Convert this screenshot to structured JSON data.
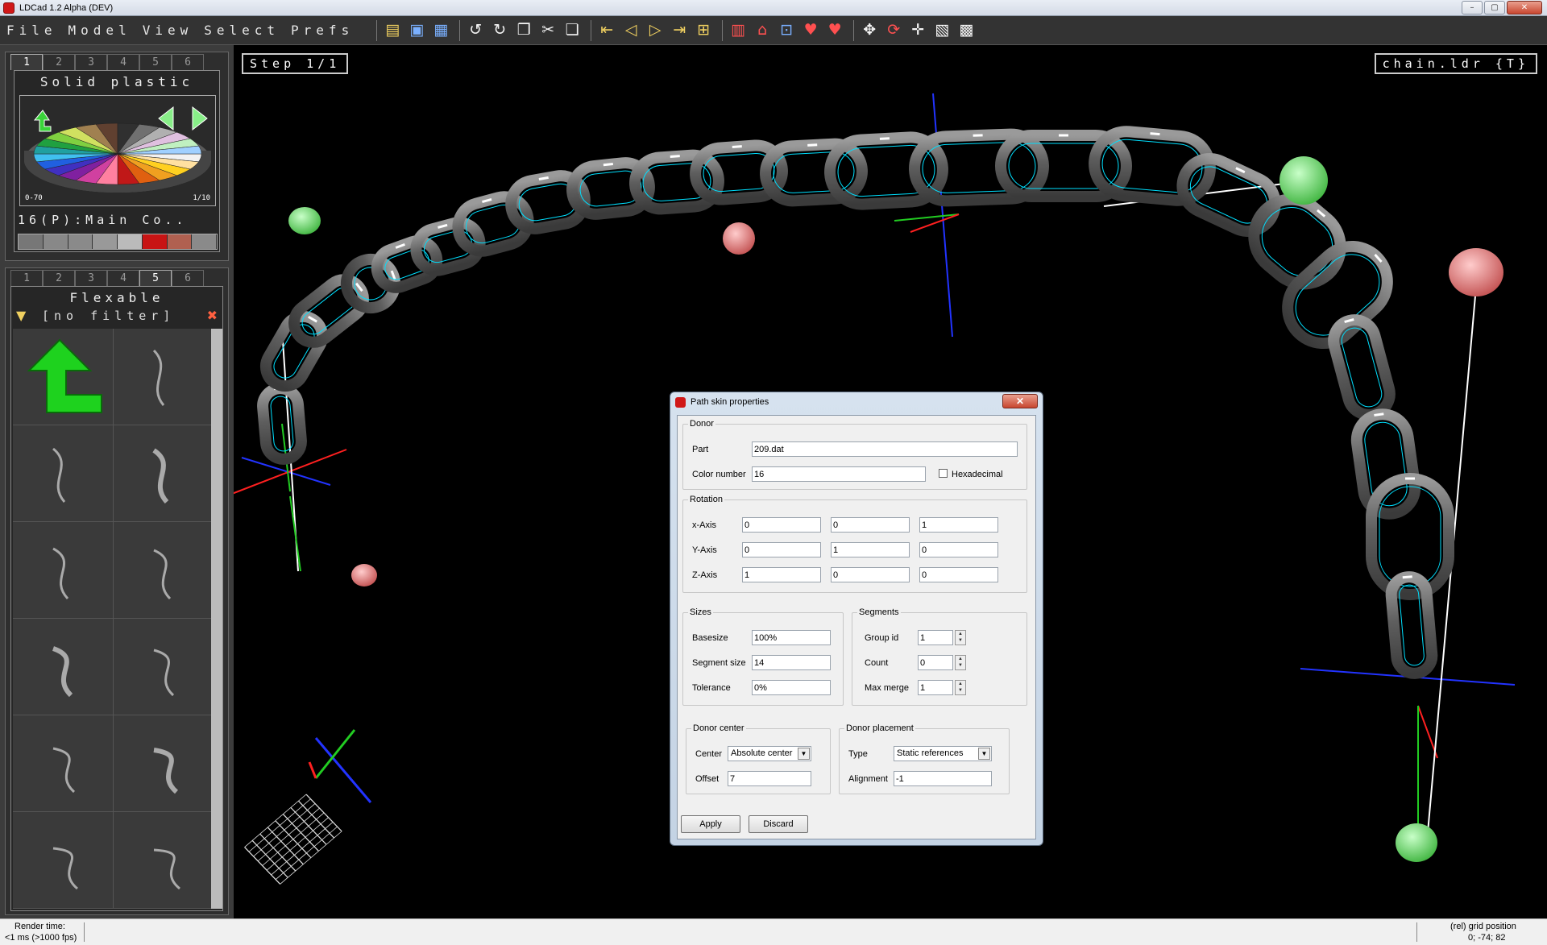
{
  "window": {
    "title": "LDCad 1.2 Alpha (DEV)",
    "buttons": [
      "–",
      "▢",
      "✕"
    ]
  },
  "menu": [
    "File",
    "Model",
    "View",
    "Select",
    "Prefs"
  ],
  "toolbar_icons": [
    "open-icon",
    "save-icon",
    "save-all-icon",
    "undo-icon",
    "redo-icon",
    "copy-icon",
    "cut-icon",
    "paste-icon",
    "step-first-icon",
    "step-prev-icon",
    "step-next-icon",
    "step-last-icon",
    "step-add-icon",
    "part-add-icon",
    "part-home-icon",
    "part-ref-icon",
    "heart-icon",
    "heart-remove-icon",
    "move-icon",
    "rotate-icon",
    "pan-icon",
    "grid-icon",
    "snap-grid-icon"
  ],
  "color_panel": {
    "tabs": [
      "1",
      "2",
      "3",
      "4",
      "5",
      "6"
    ],
    "active_tab": "1",
    "title": "Solid plastic",
    "range_left": "0-70",
    "range_right": "1/10",
    "current_color": "16(P):Main Co..",
    "swatches": [
      "#777777",
      "#888888",
      "#8a8a8a",
      "#999999",
      "#bbbbbb",
      "#c81414",
      "#b06050",
      "#8a8a8a"
    ]
  },
  "parts_panel": {
    "tabs": [
      "1",
      "2",
      "3",
      "4",
      "5",
      "6"
    ],
    "active_tab": "5",
    "title": "Flexable",
    "filter": "[no filter]"
  },
  "viewport": {
    "step": "Step 1/1",
    "model": "chain.ldr {T}"
  },
  "status": {
    "render_label": "Render time:",
    "render_value": "<1 ms (>1000 fps)",
    "grid_label": "(rel) grid position",
    "grid_value": "0; -74; 82"
  },
  "dialog": {
    "title": "Path skin properties",
    "donor": {
      "legend": "Donor",
      "part_label": "Part",
      "part_value": "209.dat",
      "color_label": "Color number",
      "color_value": "16",
      "hex_label": "Hexadecimal"
    },
    "rotation": {
      "legend": "Rotation",
      "rows": [
        {
          "label": "x-Axis",
          "values": [
            "0",
            "0",
            "1"
          ]
        },
        {
          "label": "Y-Axis",
          "values": [
            "0",
            "1",
            "0"
          ]
        },
        {
          "label": "Z-Axis",
          "values": [
            "1",
            "0",
            "0"
          ]
        }
      ]
    },
    "sizes": {
      "legend": "Sizes",
      "base_label": "Basesize",
      "base_value": "100%",
      "seg_label": "Segment size",
      "seg_value": "14",
      "tol_label": "Tolerance",
      "tol_value": "0%"
    },
    "segments": {
      "legend": "Segments",
      "group_label": "Group id",
      "group_value": "1",
      "count_label": "Count",
      "count_value": "0",
      "merge_label": "Max merge",
      "merge_value": "1"
    },
    "donor_center": {
      "legend": "Donor center",
      "center_label": "Center",
      "center_value": "Absolute center",
      "offset_label": "Offset",
      "offset_value": "7"
    },
    "donor_placement": {
      "legend": "Donor placement",
      "type_label": "Type",
      "type_value": "Static references",
      "align_label": "Alignment",
      "align_value": "-1"
    },
    "apply": "Apply",
    "discard": "Discard"
  },
  "colors": {
    "accent_cyan": "#00e0ff",
    "link_gray": "#6a6a6a",
    "node_green": "#7ee07e",
    "node_red": "#e07878",
    "arrow_green": "#22dd22"
  }
}
